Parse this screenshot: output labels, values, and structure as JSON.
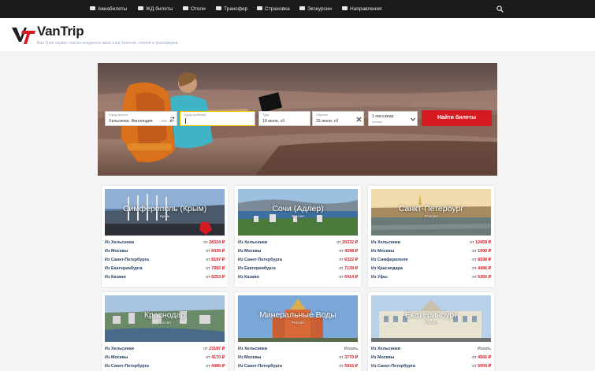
{
  "nav": {
    "items": [
      {
        "label": "Авиабилеты",
        "icon": "plane-icon"
      },
      {
        "label": "ЖД билеты",
        "icon": "train-icon"
      },
      {
        "label": "Отели",
        "icon": "bed-icon"
      },
      {
        "label": "Трансфер",
        "icon": "car-icon"
      },
      {
        "label": "Страховка",
        "icon": "id-card-icon"
      },
      {
        "label": "Экскурсии",
        "icon": "bus-icon"
      },
      {
        "label": "Направления",
        "icon": "map-icon"
      }
    ],
    "search_icon": "search-icon"
  },
  "header": {
    "brand": "VanTrip",
    "tagline": "Ван Трип сервис поиска недорогих авиа и жд билетов, отелей и трансферов."
  },
  "search": {
    "from_label": "Город вылета",
    "from_value": "Хельсинки, Финляндия",
    "from_code": "HEL",
    "to_label": "Город прибытия",
    "to_value": "",
    "depart_label": "Туда",
    "depart_value": "18 июля, сб",
    "return_label": "Обратно",
    "return_value": "25 июля, сб",
    "passengers_label": "1 пассажир",
    "class_label": "эконом",
    "button": "Найти билеты"
  },
  "colors": {
    "accent": "#d61a21",
    "nav_bg": "#1b1b1b"
  },
  "cards": [
    {
      "city": "Симферополь (Крым)",
      "country": "Крым",
      "rows": [
        {
          "from": "Из Хельсинки",
          "price": "от 28324 ₽"
        },
        {
          "from": "Из Москвы",
          "price": "от 6439 ₽"
        },
        {
          "from": "Из Санкт-Петербурга",
          "price": "от 8197 ₽"
        },
        {
          "from": "Из Екатеринбурга",
          "price": "от 7892 ₽"
        },
        {
          "from": "Из Казани",
          "price": "от 6253 ₽"
        }
      ]
    },
    {
      "city": "Сочи (Адлер)",
      "country": "Россия",
      "rows": [
        {
          "from": "Из Хельсинки",
          "price": "от 20332 ₽"
        },
        {
          "from": "Из Москвы",
          "price": "от 4298 ₽"
        },
        {
          "from": "Из Санкт-Петербурга",
          "price": "от 6322 ₽"
        },
        {
          "from": "Из Екатеринбурга",
          "price": "от 7139 ₽"
        },
        {
          "from": "Из Казани",
          "price": "от 6414 ₽"
        }
      ]
    },
    {
      "city": "Санкт-Петербург",
      "country": "Россия",
      "rows": [
        {
          "from": "Из Хельсинки",
          "price": "от 12458 ₽"
        },
        {
          "from": "Из Москвы",
          "price": "от 1990 ₽"
        },
        {
          "from": "Из Симферополя",
          "price": "от 8198 ₽"
        },
        {
          "from": "Из Краснодара",
          "price": "от 4486 ₽"
        },
        {
          "from": "Из Уфы",
          "price": "от 5360 ₽"
        }
      ]
    },
    {
      "city": "Краснодар",
      "country": "Россия",
      "rows": [
        {
          "from": "Из Хельсинки",
          "price": "от 23187 ₽"
        },
        {
          "from": "Из Москвы",
          "price": "от 4170 ₽"
        },
        {
          "from": "Из Санкт-Петербурга",
          "price": "от 4486 ₽"
        }
      ]
    },
    {
      "city": "Минеральные Воды",
      "country": "Россия",
      "rows": [
        {
          "from": "Из Хельсинки",
          "price": "Искать"
        },
        {
          "from": "Из Москвы",
          "price": "от 3770 ₽"
        },
        {
          "from": "Из Санкт-Петербурга",
          "price": "от 5915 ₽"
        }
      ]
    },
    {
      "city": "Екатеринбург",
      "country": "Россия",
      "rows": [
        {
          "from": "Из Хельсинки",
          "price": "Искать"
        },
        {
          "from": "Из Москвы",
          "price": "от 4566 ₽"
        },
        {
          "from": "Из Санкт-Петербурга",
          "price": "от 5000 ₽"
        }
      ]
    }
  ]
}
